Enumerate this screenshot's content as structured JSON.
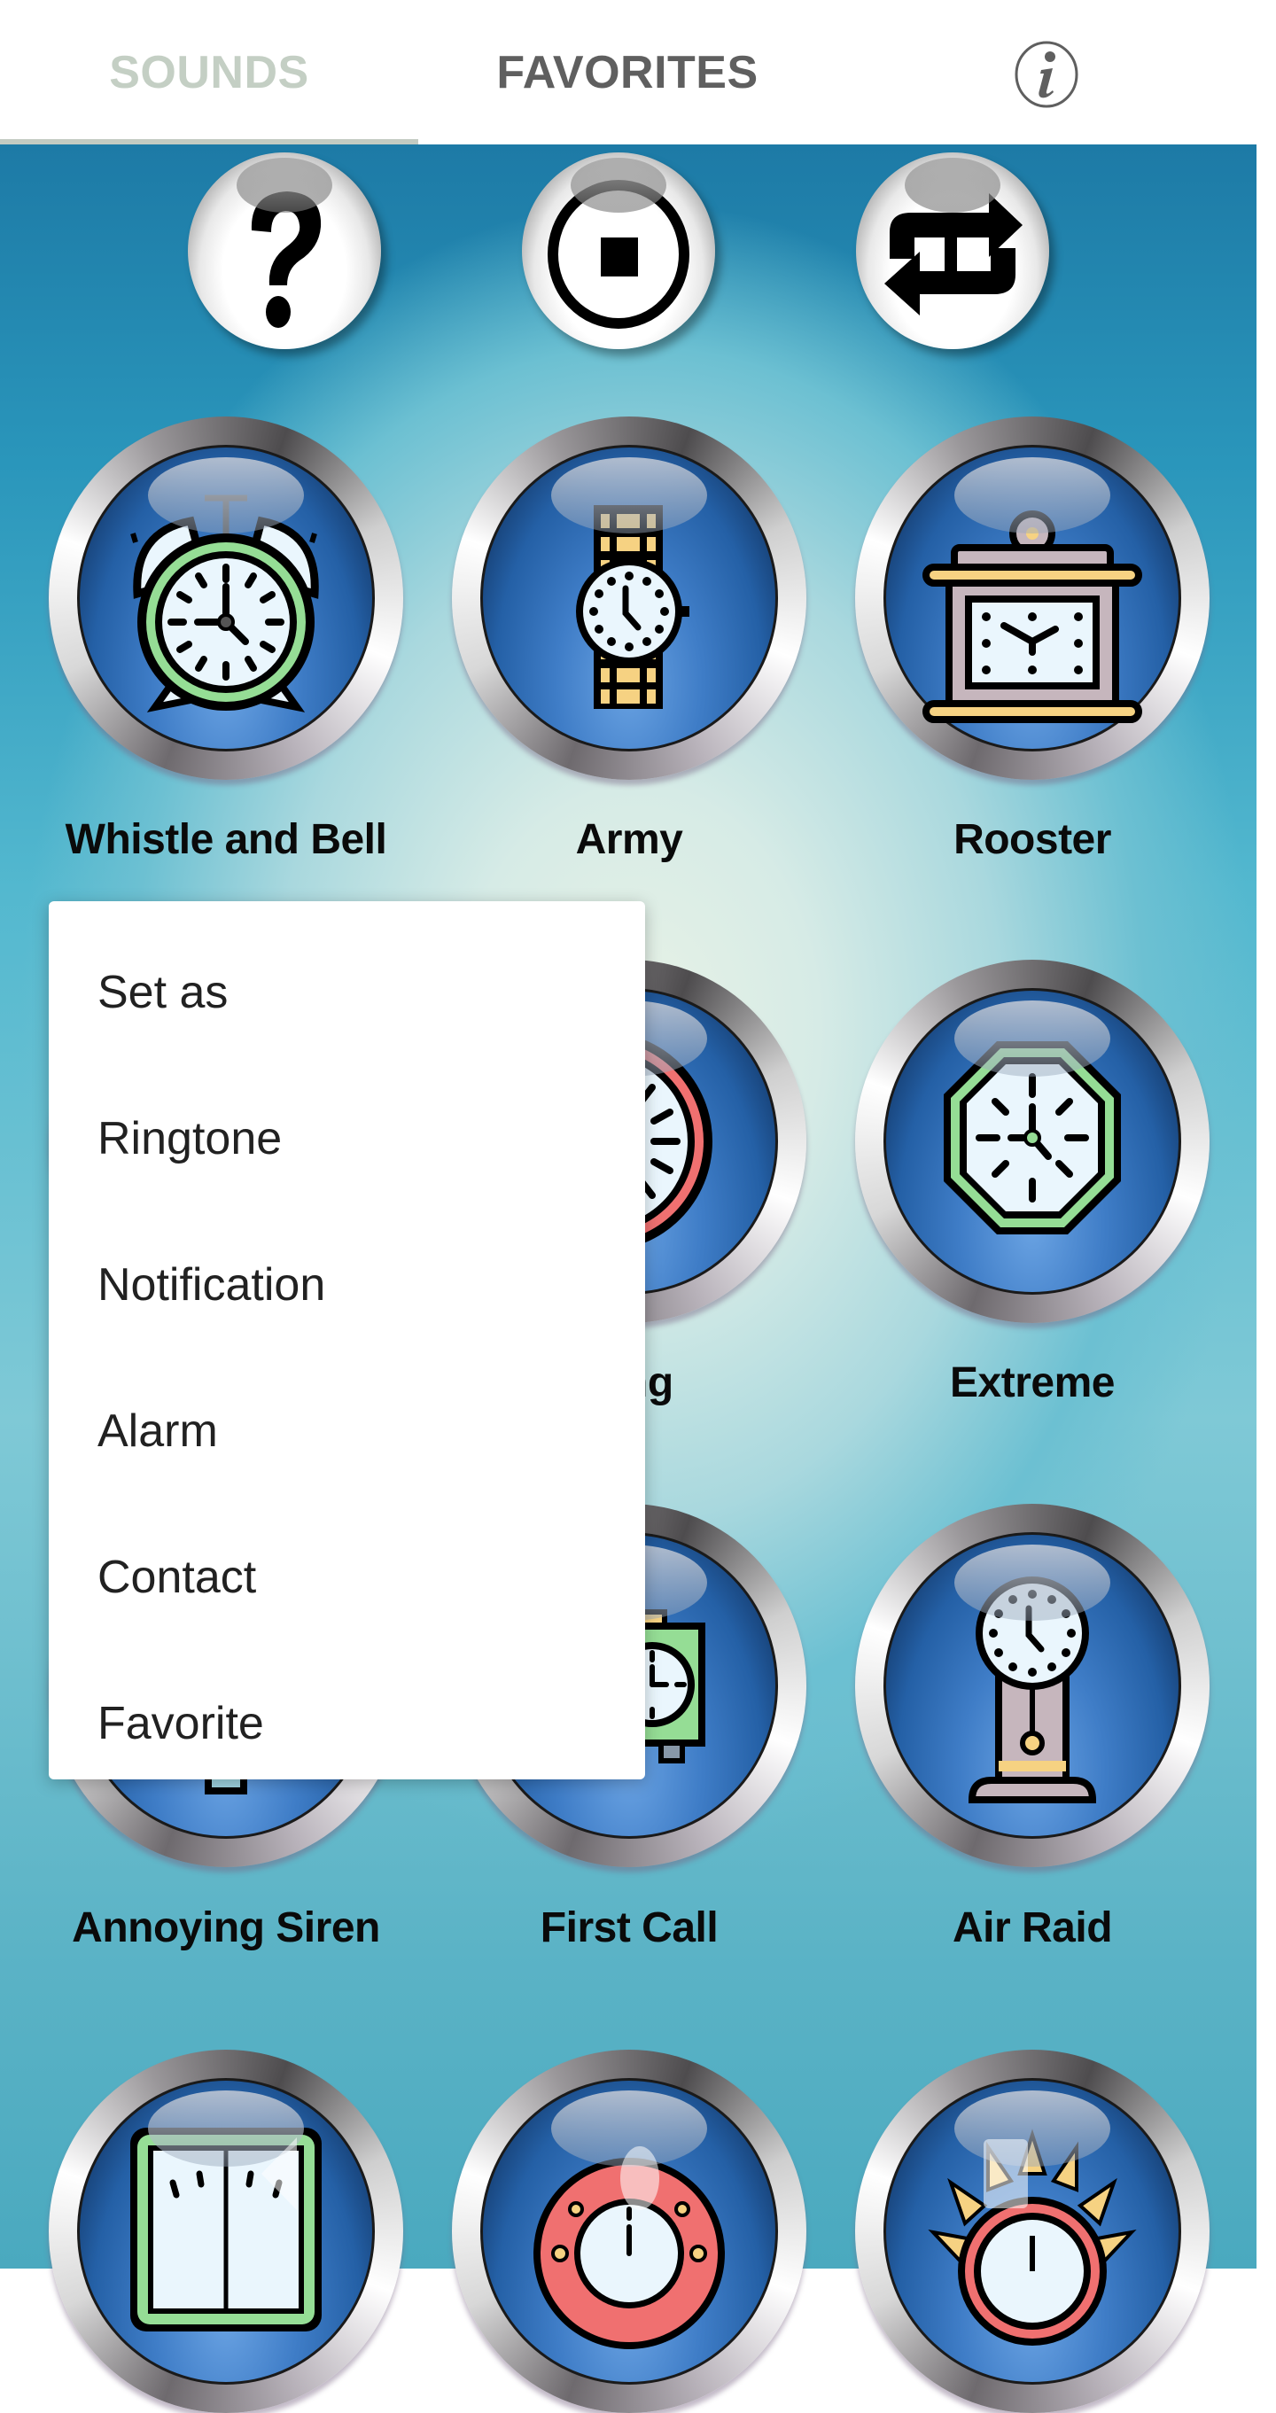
{
  "tabs": [
    {
      "label": "SOUNDS",
      "active": true
    },
    {
      "label": "FAVORITES",
      "active": false
    }
  ],
  "header": {
    "info_icon": "info-icon",
    "active_tab_indicator_color": "#c3cbc2"
  },
  "controls": [
    {
      "name": "help",
      "icon": "question-mark-icon"
    },
    {
      "name": "stop",
      "icon": "stop-circle-icon"
    },
    {
      "name": "repeat",
      "icon": "repeat-icon"
    }
  ],
  "sounds": [
    {
      "label": "Whistle and Bell",
      "icon": "alarm-clock-icon"
    },
    {
      "label": "Army",
      "icon": "wristwatch-icon"
    },
    {
      "label": "Rooster",
      "icon": "mantel-clock-icon"
    },
    {
      "label": "ning",
      "icon": "stopwatch-icon"
    },
    {
      "label": "Extreme",
      "icon": "octagon-clock-icon"
    },
    {
      "label": "Annoying Siren",
      "icon": "clock-icon"
    },
    {
      "label": "First Call",
      "icon": "cuckoo-clock-icon"
    },
    {
      "label": "Air Raid",
      "icon": "pendulum-clock-icon"
    },
    {
      "label": "",
      "icon": "square-clock-icon"
    },
    {
      "label": "",
      "icon": "ornate-clock-icon"
    },
    {
      "label": "",
      "icon": "sun-clock-icon"
    }
  ],
  "popup_menu": {
    "items": [
      "Set as",
      "Ringtone",
      "Notification",
      "Alarm",
      "Contact",
      "Favorite"
    ]
  },
  "nav_bar": {
    "keys": [
      "back-icon",
      "home-icon",
      "recents-icon"
    ]
  },
  "colors": {
    "tab_inactive": "#c4cfc4",
    "tab_text": "#5f5f5f",
    "button_face": "#2460a6",
    "accent_green": "#95dd95",
    "accent_yellow": "#f6d282",
    "accent_red": "#f07070"
  }
}
